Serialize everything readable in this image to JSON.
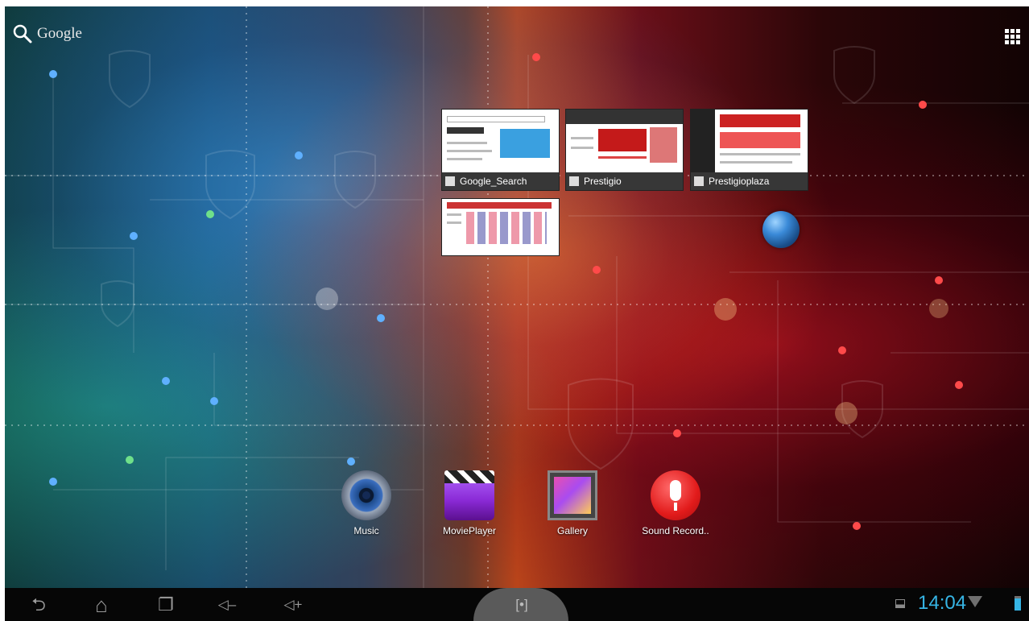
{
  "search": {
    "label": "Google",
    "icon": "search-icon"
  },
  "apps_button": {
    "icon": "all-apps-grid-icon"
  },
  "bookmarks": [
    {
      "title": "Google_Search",
      "icon": "google-favicon"
    },
    {
      "title": "Prestigio",
      "icon": "prestigio-favicon"
    },
    {
      "title": "Prestigioplaza",
      "icon": "prestigioplaza-favicon"
    },
    {
      "title": "",
      "icon": ""
    }
  ],
  "globe_widget": {
    "icon": "browser-globe-icon"
  },
  "dock": [
    {
      "label": "Music",
      "icon": "music-speaker-icon"
    },
    {
      "label": "MoviePlayer",
      "icon": "movie-clapper-icon"
    },
    {
      "label": "Gallery",
      "icon": "gallery-picture-icon"
    },
    {
      "label": "Sound Record..",
      "icon": "microphone-icon"
    }
  ],
  "sysbar": {
    "back": "⮌",
    "home": "⌂",
    "recents": "❐",
    "vol_down": "◁–",
    "vol_up": "◁+",
    "screenshot": "[•]",
    "time": "14:04",
    "colors": {
      "clock": "#36b5e5",
      "bar": "#060606"
    }
  }
}
